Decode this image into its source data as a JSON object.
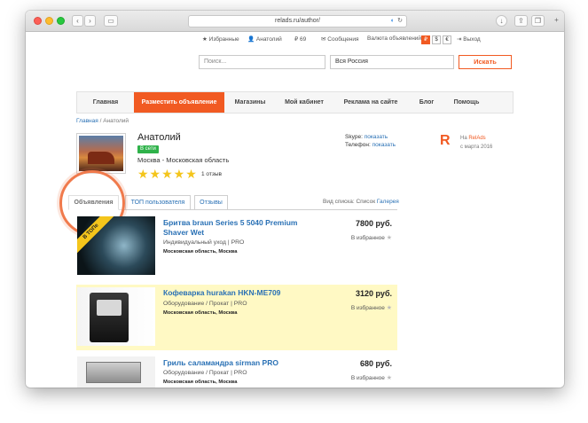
{
  "browser": {
    "url": "relads.ru/author/"
  },
  "topbar": {
    "favorites": "Избранные",
    "user": "Анатолий",
    "coins": "69",
    "messages": "Сообщения",
    "currency_label": "Валюта объявлений:",
    "currencies": [
      "₽",
      "$",
      "€"
    ],
    "logout": "Выход"
  },
  "search": {
    "query_placeholder": "Поиск...",
    "region_value": "Вся Россия",
    "button": "Искать"
  },
  "nav": {
    "items": [
      {
        "label": "Главная"
      },
      {
        "label": "Разместить объявление"
      },
      {
        "label": "Магазины"
      },
      {
        "label": "Мой кабинет"
      },
      {
        "label": "Реклама на сайте"
      },
      {
        "label": "Блог"
      },
      {
        "label": "Помощь"
      }
    ]
  },
  "breadcrumb": {
    "home": "Главная",
    "separator": "/",
    "current": "Анатолий"
  },
  "profile": {
    "name": "Анатолий",
    "status": "В сети",
    "region": "Москва - Московская область",
    "rating": "★★★★★",
    "reviews": "1 отзыв",
    "skype_label": "Skype:",
    "skype_link": "показать",
    "phone_label": "Телефон:",
    "phone_link": "показать",
    "site_logo": "R",
    "on_site_prefix": "На",
    "site_name": "RelAds",
    "since": "с марта 2016"
  },
  "tabs": {
    "items": [
      {
        "label": "Объявления"
      },
      {
        "label": "ТОП пользователя"
      },
      {
        "label": "Отзывы"
      }
    ],
    "view_label": "Вид списка:",
    "view_list": "Список",
    "view_gallery": "Галерея"
  },
  "listings": [
    {
      "title": "Бритва braun Series 5 5040 Premium Shaver Wet",
      "category": "Индивидуальный уход | PRO",
      "location": "Московская область, Москва",
      "price": "7800 руб.",
      "favorite": "В избранное",
      "badge": "В ТОПе"
    },
    {
      "title": "Кофеварка hurakan HKN-ME709",
      "category": "Оборудование / Прокат | PRO",
      "location": "Московская область, Москва",
      "price": "3120 руб.",
      "favorite": "В избранное"
    },
    {
      "title": "Гриль саламандра sirman PRO",
      "category": "Оборудование / Прокат | PRO",
      "location": "Московская область, Москва",
      "price": "680 руб.",
      "favorite": "В избранное"
    }
  ],
  "colors": {
    "accent": "#f15a22",
    "link": "#2a71b5",
    "featured_bg": "#fff9c4",
    "online": "#2fb24a"
  }
}
